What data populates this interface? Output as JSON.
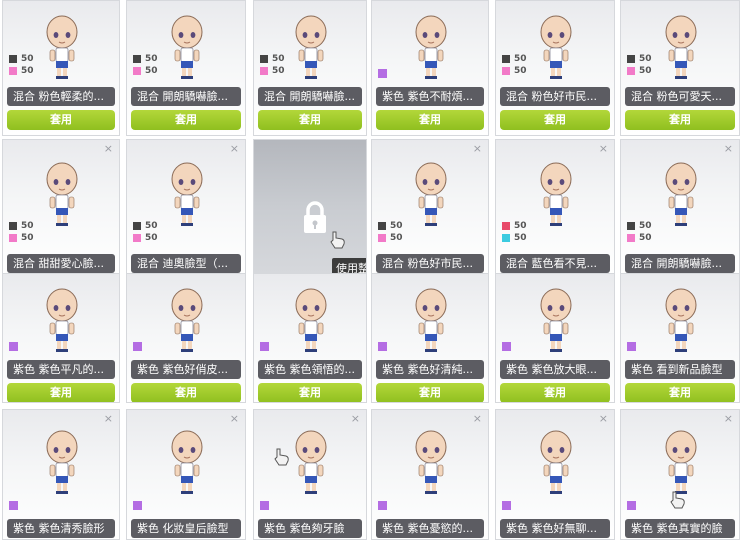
{
  "cards": [
    {
      "name": "混合  粉色輕柔的...",
      "button": "套用",
      "closable": false,
      "swatch": "pair",
      "c1": "#444444",
      "c2": "#f27ac8",
      "v1": "50",
      "v2": "50"
    },
    {
      "name": "混合  開朗驕嚇臉...",
      "button": "套用",
      "closable": false,
      "swatch": "pair",
      "c1": "#444444",
      "c2": "#f27ac8",
      "v1": "50",
      "v2": "50"
    },
    {
      "name": "混合  開朗驕嚇臉...",
      "button": "套用",
      "closable": false,
      "swatch": "pair",
      "c1": "#444444",
      "c2": "#f27ac8",
      "v1": "50",
      "v2": "50"
    },
    {
      "name": "紫色  紫色不耐煩...",
      "button": "套用",
      "closable": false,
      "swatch": "single",
      "c1": "#b46de3"
    },
    {
      "name": "混合  粉色好市民...",
      "button": "套用",
      "closable": false,
      "swatch": "pair",
      "c1": "#444444",
      "c2": "#f27ac8",
      "v1": "50",
      "v2": "50"
    },
    {
      "name": "混合  粉色可愛天...",
      "button": "套用",
      "closable": false,
      "swatch": "pair",
      "c1": "#444444",
      "c2": "#f27ac8",
      "v1": "50",
      "v2": "50"
    },
    {
      "name": "混合  甜甜愛心臉...",
      "button": "",
      "closable": true,
      "swatch": "pair",
      "c1": "#444444",
      "c2": "#f27ac8",
      "v1": "50",
      "v2": "50"
    },
    {
      "name": "混合  迪奧臉型（...",
      "button": "",
      "closable": true,
      "swatch": "pair",
      "c1": "#444444",
      "c2": "#f27ac8",
      "v1": "50",
      "v2": "50"
    },
    {
      "locked": true,
      "tooltip": "使用整"
    },
    {
      "name": "混合  粉色好市民...",
      "button": "",
      "closable": true,
      "swatch": "pair",
      "c1": "#444444",
      "c2": "#f27ac8",
      "v1": "50",
      "v2": "50"
    },
    {
      "name": "混合  藍色看不見...",
      "button": "",
      "closable": true,
      "swatch": "pair",
      "c1": "#e84a6a",
      "c2": "#3ccbe0",
      "v1": "50",
      "v2": "50"
    },
    {
      "name": "混合  開朗驕嚇臉...",
      "button": "",
      "closable": true,
      "swatch": "pair",
      "c1": "#444444",
      "c2": "#f27ac8",
      "v1": "50",
      "v2": "50"
    },
    {
      "name": "紫色  紫色平凡的...",
      "button": "套用",
      "closable": false,
      "swatch": "single",
      "c1": "#b46de3"
    },
    {
      "name": "紫色  紫色好俏皮...",
      "button": "套用",
      "closable": false,
      "swatch": "single",
      "c1": "#b46de3"
    },
    {
      "name": "紫色  紫色領悟的...",
      "button": "套用",
      "closable": false,
      "swatch": "single",
      "c1": "#b46de3"
    },
    {
      "name": "紫色  紫色好清純...",
      "button": "套用",
      "closable": false,
      "swatch": "single",
      "c1": "#b46de3"
    },
    {
      "name": "紫色  紫色放大眼...",
      "button": "套用",
      "closable": false,
      "swatch": "single",
      "c1": "#b46de3"
    },
    {
      "name": "紫色  看到新品臉型",
      "button": "套用",
      "closable": false,
      "swatch": "single",
      "c1": "#b46de3"
    },
    {
      "name": "紫色  紫色清秀臉形",
      "button": "",
      "closable": true,
      "swatch": "single",
      "c1": "#b46de3"
    },
    {
      "name": "紫色  化妝皇后臉型",
      "button": "",
      "closable": true,
      "swatch": "single",
      "c1": "#b46de3"
    },
    {
      "name": "紫色  紫色夠牙臉",
      "button": "",
      "closable": true,
      "swatch": "single",
      "c1": "#b46de3"
    },
    {
      "name": "紫色  紫色憂慾的...",
      "button": "",
      "closable": true,
      "swatch": "single",
      "c1": "#b46de3"
    },
    {
      "name": "紫色  紫色好無聊...",
      "button": "",
      "closable": true,
      "swatch": "single",
      "c1": "#b46de3"
    },
    {
      "name": "紫色  紫色真實的臉",
      "button": "",
      "closable": true,
      "swatch": "single",
      "c1": "#b46de3"
    }
  ],
  "close_glyph": "×"
}
